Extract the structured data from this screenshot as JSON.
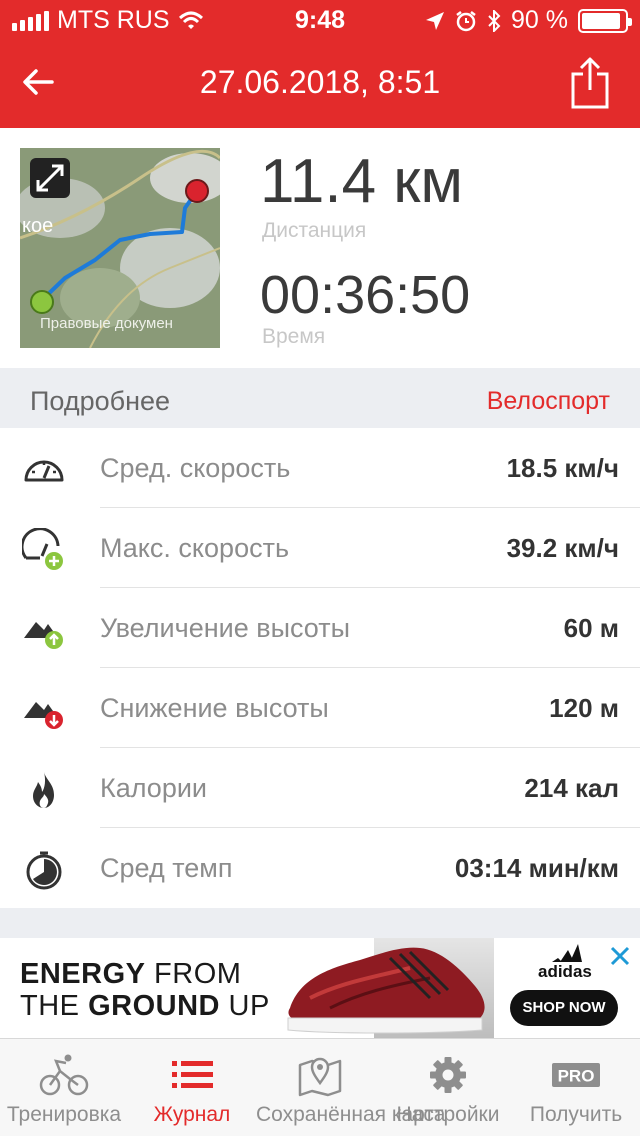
{
  "status_bar": {
    "carrier": "MTS RUS",
    "time": "9:48",
    "battery": "90 %",
    "battery_level": 0.9
  },
  "nav": {
    "title": "27.06.2018, 8:51",
    "back_icon": "back-arrow-icon",
    "share_icon": "share-icon"
  },
  "summary": {
    "distance_value": "11.4 км",
    "distance_label": "Дистанция",
    "time_value": "00:36:50",
    "time_label": "Время",
    "map_text_1": "кое",
    "map_text_2": "Правовые докумен"
  },
  "details": {
    "header": "Подробнее",
    "activity": "Велоспорт",
    "rows": [
      {
        "icon": "speedometer-icon",
        "label": "Сред. скорость",
        "value": "18.5 км/ч"
      },
      {
        "icon": "speedometer-plus-icon",
        "label": "Макс. скорость",
        "value": "39.2 км/ч"
      },
      {
        "icon": "elevation-gain-icon",
        "label": "Увеличение высоты",
        "value": "60 м"
      },
      {
        "icon": "elevation-loss-icon",
        "label": "Снижение высоты",
        "value": "120 м"
      },
      {
        "icon": "flame-icon",
        "label": "Калории",
        "value": "214 кал"
      },
      {
        "icon": "stopwatch-icon",
        "label": "Сред темп",
        "value": "03:14 мин/км"
      }
    ]
  },
  "ad": {
    "line1_bold": "ENERGY",
    "line1_rest": " FROM",
    "line2_pre": "THE ",
    "line2_bold": "GROUND",
    "line2_rest": " UP",
    "brand": "adidas",
    "cta": "SHOP NOW"
  },
  "tabbar": {
    "tabs": [
      {
        "label": "Тренировка",
        "icon": "cyclist-icon",
        "active": false
      },
      {
        "label": "Журнал",
        "icon": "list-icon",
        "active": true
      },
      {
        "label": "Сохранённая карта",
        "icon": "map-pin-icon",
        "active": false
      },
      {
        "label": "Настройки",
        "icon": "gear-icon",
        "active": false
      },
      {
        "label": "Получить",
        "icon": "pro-badge-icon",
        "badge": "PRO",
        "active": false
      }
    ]
  },
  "colors": {
    "brand_red": "#e32b2b",
    "section_bg": "#eceef2",
    "route_blue": "#1e7bd9",
    "start_green": "#8cc63f",
    "end_red": "#d9232e"
  }
}
